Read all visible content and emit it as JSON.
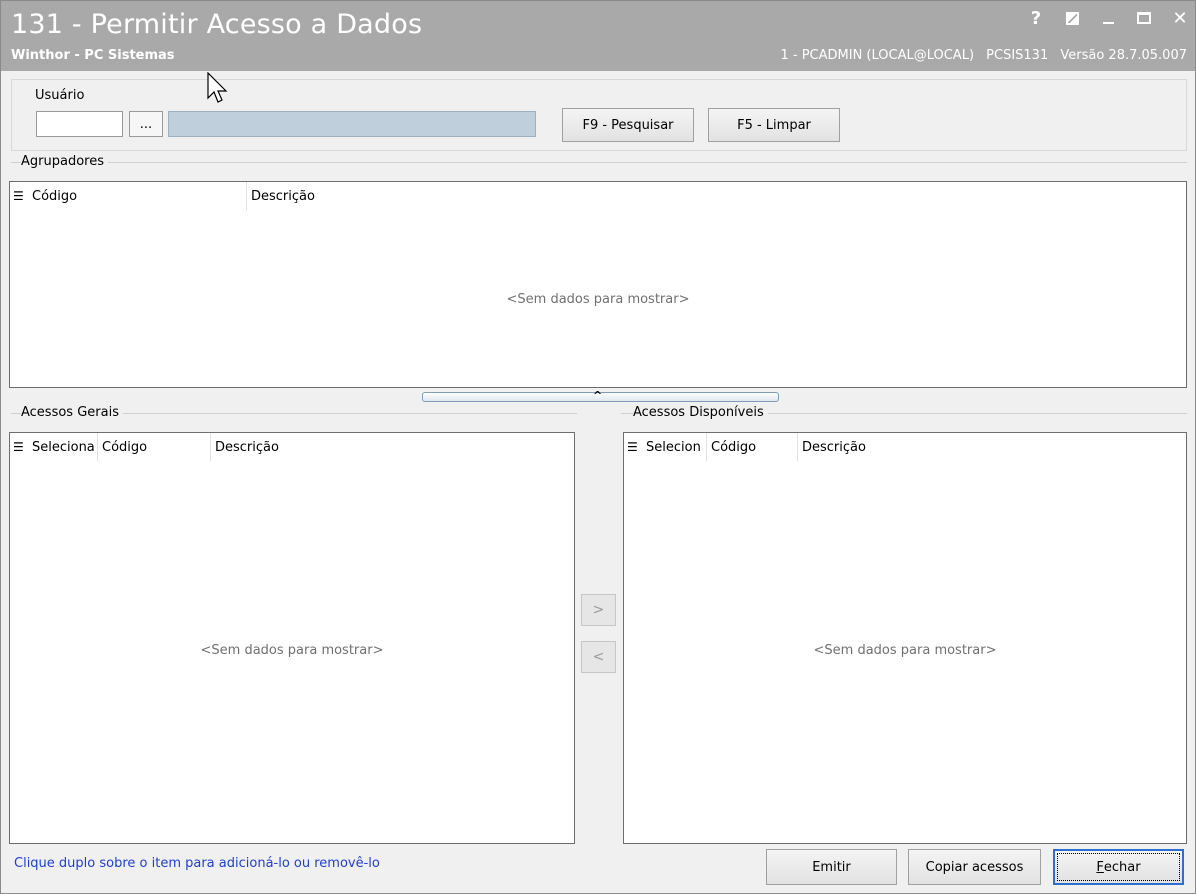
{
  "window": {
    "title": "131 - Permitir Acesso a Dados",
    "subtitle": "Winthor - PC Sistemas",
    "session": "1 - PCADMIN (LOCAL@LOCAL)",
    "routine": "PCSIS131",
    "version": "Versão 28.7.05.007",
    "controls": [
      "help-icon",
      "edit-icon",
      "minimize-icon",
      "maximize-icon",
      "close-icon"
    ]
  },
  "search": {
    "user_label": "Usuário",
    "user_code_value": "",
    "lookup_label": "...",
    "user_name_value": "",
    "search_button": "F9 - Pesquisar",
    "clear_button": "F5 - Limpar"
  },
  "agrupadores": {
    "title": "Agrupadores",
    "columns": [
      "Código",
      "Descrição"
    ],
    "rows": [],
    "empty": "<Sem dados para mostrar>"
  },
  "acessos_gerais": {
    "title": "Acessos Gerais",
    "columns": [
      "Seleciona",
      "Código",
      "Descrição"
    ],
    "rows": [],
    "empty": "<Sem dados para mostrar>"
  },
  "acessos_disponiveis": {
    "title": "Acessos Disponíveis",
    "columns": [
      "Selecion",
      "Código",
      "Descrição"
    ],
    "rows": [],
    "empty": "<Sem dados para mostrar>"
  },
  "transfer": {
    "add_label": ">",
    "remove_label": "<"
  },
  "footer": {
    "hint": "Clique duplo sobre o item para adicioná-lo ou removê-lo",
    "emitir": "Emitir",
    "copiar": "Copiar acessos",
    "fechar_first": "F",
    "fechar_rest": "echar"
  }
}
